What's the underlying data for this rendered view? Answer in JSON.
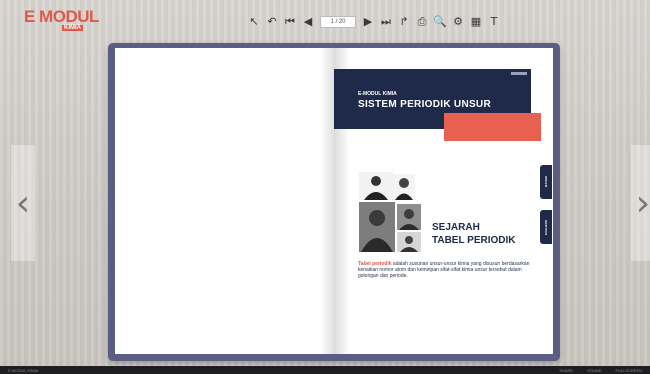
{
  "logo": {
    "main": "E MODUL",
    "sub": "KIMIA"
  },
  "toolbar": {
    "page_indicator": "1 / 20",
    "buttons": [
      {
        "name": "select-tool-icon",
        "glyph": "↖"
      },
      {
        "name": "undo-icon",
        "glyph": "↶"
      },
      {
        "name": "first-page-icon",
        "glyph": "⏮"
      },
      {
        "name": "prev-page-icon",
        "glyph": "◀"
      },
      {
        "name": "next-page-icon",
        "glyph": "▶"
      },
      {
        "name": "last-page-icon",
        "glyph": "⏭"
      },
      {
        "name": "share-icon",
        "glyph": "↱"
      },
      {
        "name": "print-icon",
        "glyph": "⎙"
      },
      {
        "name": "zoom-icon",
        "glyph": "🔍"
      },
      {
        "name": "settings-icon",
        "glyph": "⚙"
      },
      {
        "name": "thumbnails-icon",
        "glyph": "▦"
      },
      {
        "name": "text-icon",
        "glyph": "T"
      }
    ]
  },
  "nav": {
    "left": "‹",
    "right": "›"
  },
  "cover": {
    "kicker": "E-MODUL KIMIA",
    "title": "SISTEM PERIODIK UNSUR",
    "heading_line1": "SEJARAH",
    "heading_line2": "TABEL PERIODIK",
    "body_highlight": "Tabel periodik",
    "body": " adalah susunan unsur-unsur kimia yang disusun berdasarkan kenaikan nomor atom dan kemiripan sifat-sifat kimia unsur tersebut dalam golongan dan periode."
  },
  "side_tabs": [
    "MATERI",
    "EVALUASI"
  ],
  "bottom_bar": {
    "left": "E-MODUL KIMIA",
    "right": [
      "SHARE",
      "SOUND",
      "FULLSCREEN"
    ]
  }
}
